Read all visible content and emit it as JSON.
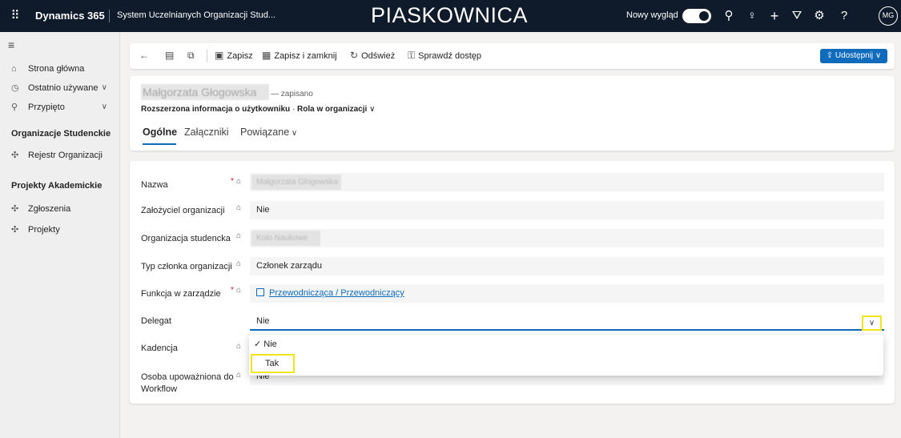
{
  "topbar": {
    "brand": "Dynamics 365",
    "app_name": "System Uczelnianych Organizacji Stud...",
    "environment": "PIASKOWNICA",
    "new_look_label": "Nowy wygląd",
    "avatar_initials": "MG",
    "icons": [
      "waffle-icon",
      "search-icon",
      "lightbulb-icon",
      "plus-icon",
      "filter-icon",
      "settings-icon",
      "help-icon"
    ]
  },
  "sidebar": {
    "items": [
      {
        "label": "Strona główna",
        "icon": "home-icon"
      },
      {
        "label": "Ostatnio używane",
        "icon": "clock-icon"
      },
      {
        "label": "Przypięto",
        "icon": "pin-icon"
      }
    ],
    "sections": [
      {
        "title": "Organizacje Studenckie",
        "items": [
          {
            "label": "Rejestr Organizacji",
            "icon": "puzzle-icon"
          }
        ]
      },
      {
        "title": "Projekty Akademickie",
        "items": [
          {
            "label": "Zgłoszenia",
            "icon": "puzzle-icon"
          },
          {
            "label": "Projekty",
            "icon": "puzzle-icon"
          }
        ]
      }
    ]
  },
  "commandbar": {
    "save": "Zapisz",
    "save_close": "Zapisz i zamknij",
    "refresh": "Odśwież",
    "check_access": "Sprawdź dostęp",
    "share": "Udostępnij"
  },
  "header": {
    "record_name": "Małgorzata Głogowska",
    "status": "— zapisano",
    "entity": "Rozszerzona informacja o użytkowniku",
    "form_selector": "Rola w organizacji",
    "tabs": [
      "Ogólne",
      "Załączniki",
      "Powiązane"
    ]
  },
  "form": {
    "fields": [
      {
        "label": "Nazwa",
        "value": "Małgorzata Głogowska",
        "required": true
      },
      {
        "label": "Założyciel organizacji",
        "value": "Nie"
      },
      {
        "label": "Organizacja studencka",
        "value": "Koło Naukowe"
      },
      {
        "label": "Typ członka organizacji",
        "value": "Członek zarządu"
      },
      {
        "label": "Funkcja w zarządzie",
        "value": "Przewodnicząca / Przewodniczący",
        "required": true
      },
      {
        "label": "Delegat",
        "value": "Nie"
      },
      {
        "label": "Kadencja",
        "value": ""
      },
      {
        "label": "Osoba upoważniona do Workflow",
        "value": "Nie"
      }
    ]
  },
  "dropdown": {
    "options": [
      "Nie",
      "Tak"
    ],
    "selected": "Nie"
  }
}
